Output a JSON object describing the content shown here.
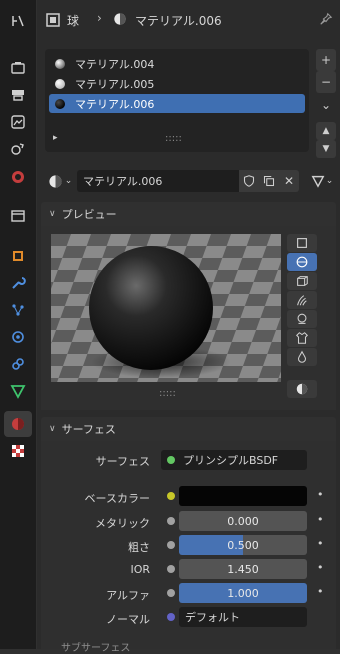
{
  "header": {
    "object_name": "球",
    "material_name": "マテリアル.006"
  },
  "material_slots": [
    {
      "label": "マテリアル.004",
      "selected": false
    },
    {
      "label": "マテリアル.005",
      "selected": false
    },
    {
      "label": "マテリアル.006",
      "selected": true
    }
  ],
  "list_drag_handle": ":::::",
  "slot_side_buttons": {
    "add": "+",
    "remove": "−",
    "menu": "⌄",
    "up": "▲",
    "down": "▼"
  },
  "datablock": {
    "material_field": "マテリアル.006"
  },
  "preview_panel": {
    "title": "プレビュー",
    "drag_handle": ":::::"
  },
  "surface_panel": {
    "title": "サーフェス",
    "surface_label": "サーフェス",
    "surface_value": "プリンシプルBSDF",
    "fields": [
      {
        "label": "ベースカラー",
        "value": "",
        "kind": "color"
      },
      {
        "label": "メタリック",
        "value": "0.000",
        "fraction": 0.0
      },
      {
        "label": "粗さ",
        "value": "0.500",
        "fraction": 0.5
      },
      {
        "label": "IOR",
        "value": "1.450",
        "fraction": 0.0
      },
      {
        "label": "アルファ",
        "value": "1.000",
        "fraction": 1.0
      },
      {
        "label": "ノーマル",
        "value": "デフォルト",
        "kind": "link"
      }
    ],
    "cutoff_text": "サブサーフェス"
  },
  "colors": {
    "accent_blue": "#4772b3",
    "material_red": "#c43d3d",
    "socket_yellow": "#c7c729",
    "socket_gray": "#a1a1a1",
    "socket_purple": "#6363c7",
    "socket_green": "#63c763"
  },
  "icons": [
    "wrench-scene-icon",
    "tool-icon",
    "render-icon",
    "output-icon",
    "view-layer-icon",
    "scene-icon",
    "world-icon",
    "collection-icon",
    "object-icon",
    "modifier-icon",
    "particles-icon",
    "physics-icon",
    "constraints-icon",
    "data-icon",
    "material-icon",
    "texture-icon"
  ]
}
